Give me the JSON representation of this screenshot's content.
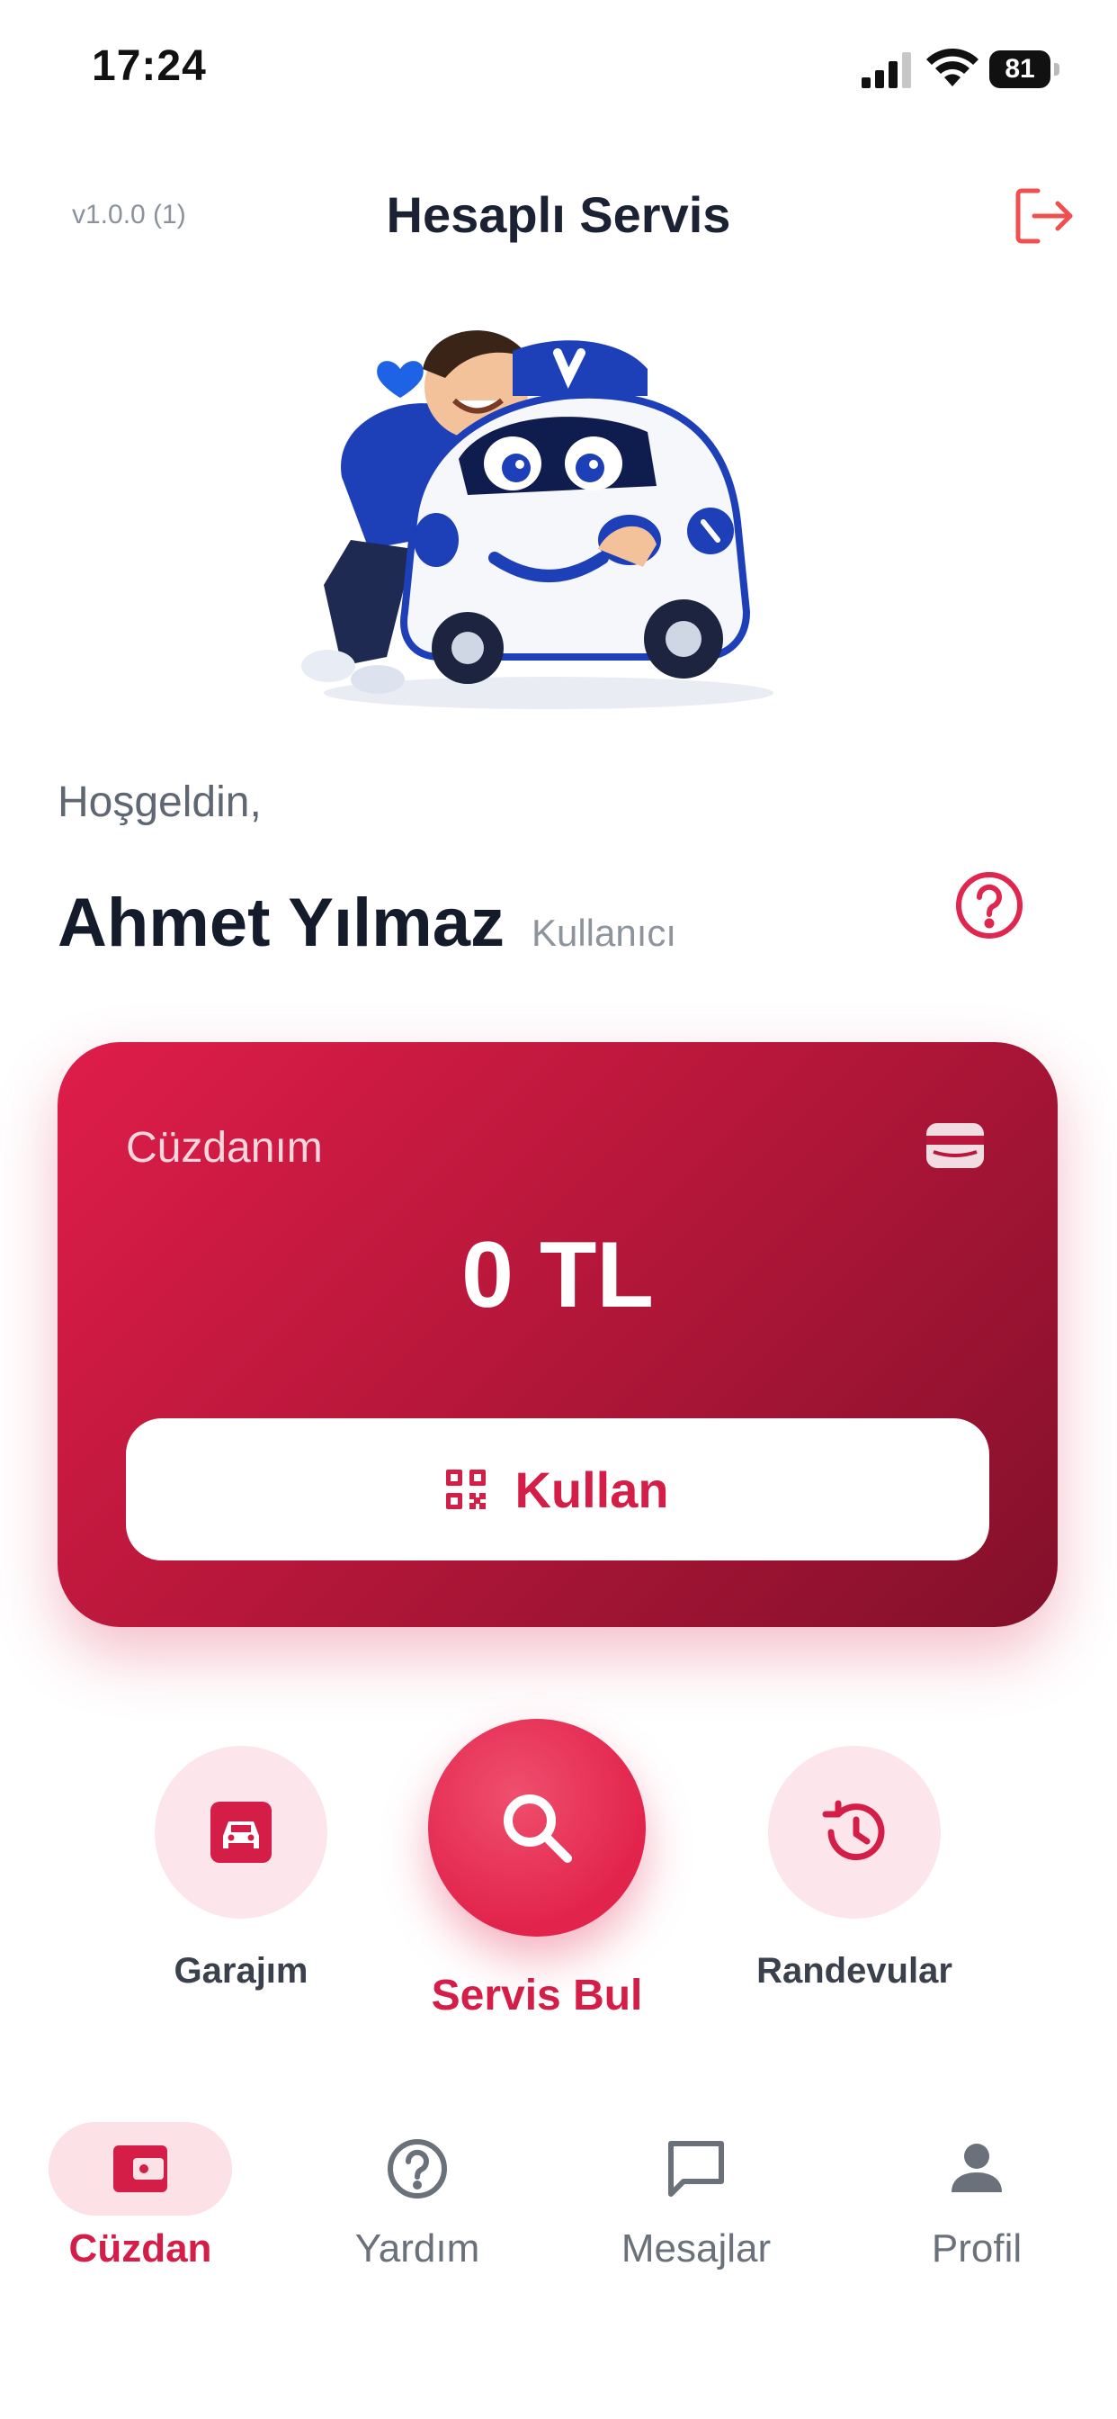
{
  "status_bar": {
    "time": "17:24",
    "battery": "81"
  },
  "header": {
    "version": "v1.0.0 (1)",
    "title": "Hesaplı Servis"
  },
  "greeting": {
    "welcome": "Hoşgeldin,",
    "name": "Ahmet Yılmaz",
    "role": "Kullanıcı"
  },
  "wallet": {
    "label": "Cüzdanım",
    "balance": "0 TL",
    "use_button": "Kullan"
  },
  "quick_actions": {
    "garage": "Garajım",
    "find_service": "Servis Bul",
    "appointments": "Randevular"
  },
  "bottom_nav": {
    "items": [
      {
        "label": "Cüzdan",
        "icon": "wallet-icon",
        "active": true
      },
      {
        "label": "Yardım",
        "icon": "help-icon",
        "active": false
      },
      {
        "label": "Mesajlar",
        "icon": "chat-icon",
        "active": false
      },
      {
        "label": "Profil",
        "icon": "person-icon",
        "active": false
      }
    ]
  },
  "colors": {
    "accent": "#d41e48",
    "accent_light": "#fce6eb",
    "card_start": "#df1d4a",
    "card_end": "#82102a"
  }
}
